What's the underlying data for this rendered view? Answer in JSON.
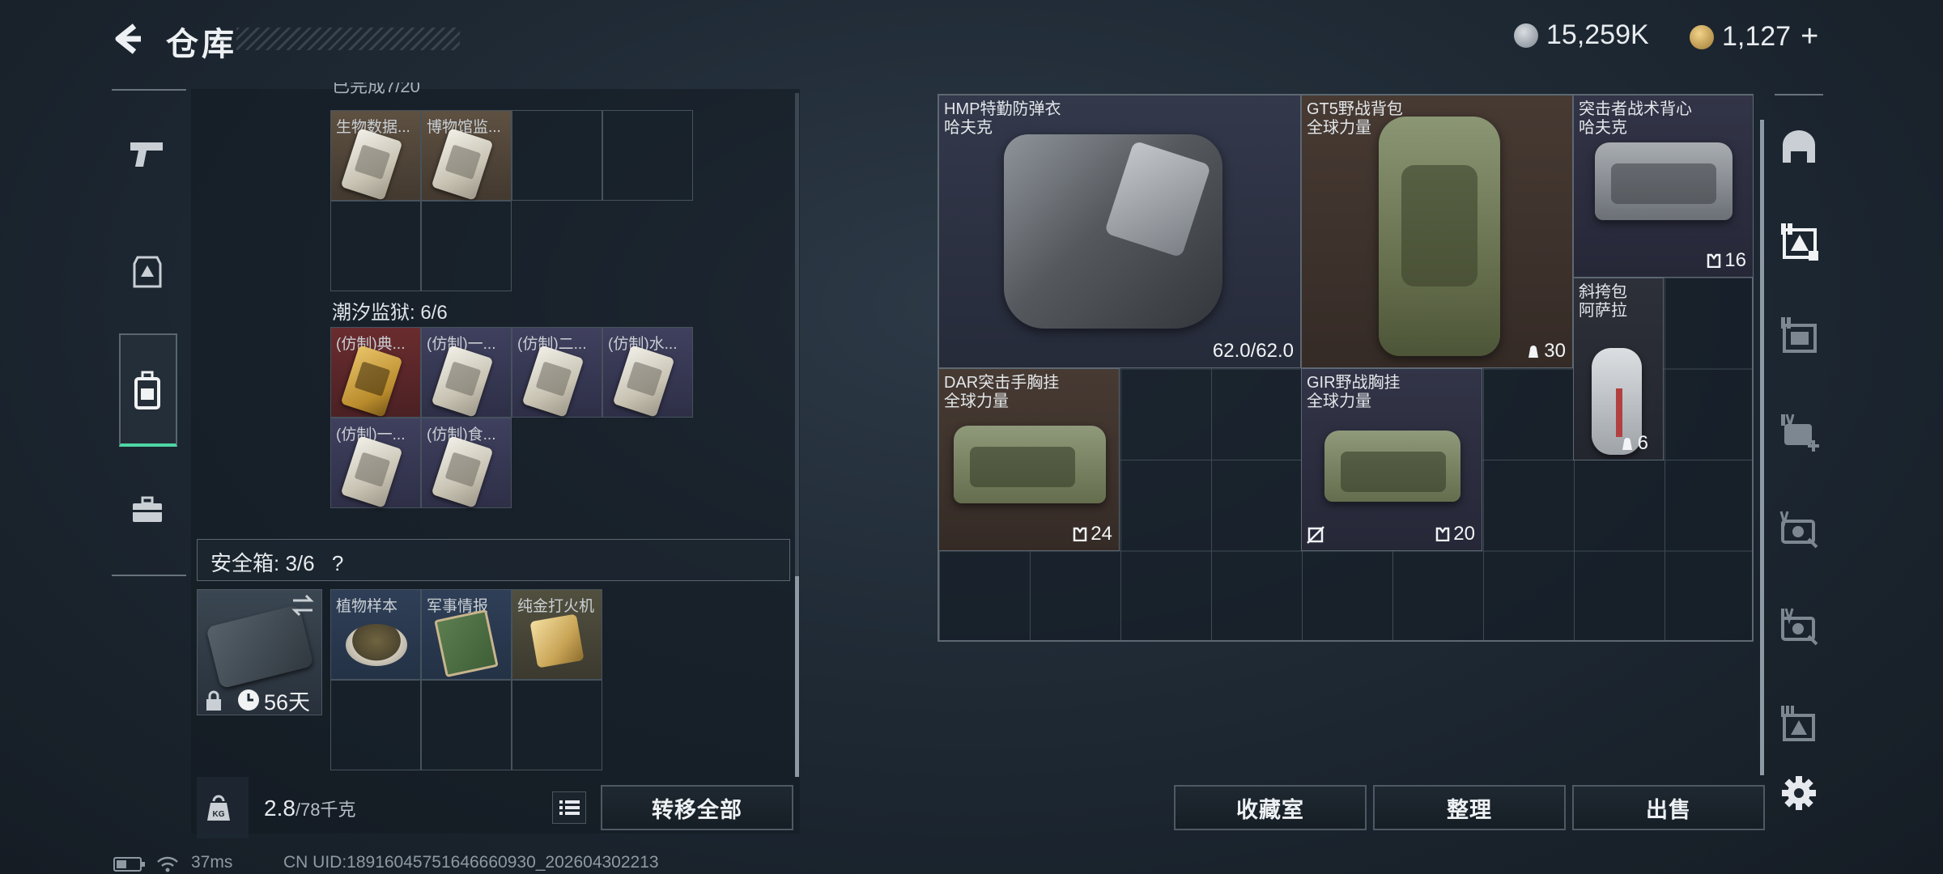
{
  "header": {
    "title": "仓库",
    "currency_silver": "15,259K",
    "currency_gold": "1,127",
    "gold_plus": "+"
  },
  "left_sidebar": {
    "items": [
      {
        "icon": "pistol-icon"
      },
      {
        "icon": "armor-icon"
      },
      {
        "icon": "backpack-icon",
        "active": true
      },
      {
        "icon": "toolbox-icon"
      }
    ]
  },
  "sections": {
    "partial_label": "已完成7/20",
    "top_items": [
      {
        "label": "生物数据...",
        "color": "tan"
      },
      {
        "label": "博物馆监...",
        "color": "tan"
      }
    ],
    "tide_prison": {
      "label": "潮汐监狱: 6/6",
      "items": [
        {
          "label": "(仿制)典...",
          "color": "red"
        },
        {
          "label": "(仿制)一...",
          "color": "purple"
        },
        {
          "label": "(仿制)二...",
          "color": "purple"
        },
        {
          "label": "(仿制)水...",
          "color": "purple"
        },
        {
          "label": "(仿制)一...",
          "color": "purple"
        },
        {
          "label": "(仿制)食...",
          "color": "purple"
        }
      ]
    }
  },
  "safe_box": {
    "label": "安全箱: 3/6",
    "help": "?",
    "timer": "56天",
    "items": [
      {
        "label": "植物样本"
      },
      {
        "label": "军事情报"
      },
      {
        "label": "纯金打火机"
      }
    ]
  },
  "footer_left": {
    "weight_value": "2.8",
    "weight_total": "/78千克",
    "transfer_all": "转移全部"
  },
  "grid_items": {
    "vest": {
      "line1": "HMP特勤防弹衣",
      "line2": "哈夫克",
      "durability": "62.0/62.0"
    },
    "backpack": {
      "line1": "GT5野战背包",
      "line2": "全球力量",
      "count": "30"
    },
    "rig_top": {
      "line1": "突击者战术背心",
      "line2": "哈夫克",
      "count": "16"
    },
    "sling": {
      "line1": "斜挎包",
      "line2": "阿萨拉",
      "count": "6"
    },
    "rig_dar": {
      "line1": "DAR突击手胸挂",
      "line2": "全球力量",
      "count": "24"
    },
    "rig_gir": {
      "line1": "GIR野战胸挂",
      "line2": "全球力量",
      "count": "20"
    }
  },
  "footer_right": {
    "collection": "收藏室",
    "sort": "整理",
    "sell": "出售"
  },
  "right_sidebar": {
    "tabs": [
      {
        "icon": "helmet-icon"
      },
      {
        "icon": "tier-ii-active-icon",
        "active": true
      },
      {
        "icon": "tier-ii-icon"
      },
      {
        "icon": "tier-iv-add-icon"
      },
      {
        "icon": "tier-v-icon"
      },
      {
        "icon": "tier-iv-icon"
      },
      {
        "icon": "tier-iii-icon"
      }
    ]
  },
  "status_bar": {
    "ping": "37ms",
    "uid": "CN UID:18916045751646660930_202604302213"
  }
}
